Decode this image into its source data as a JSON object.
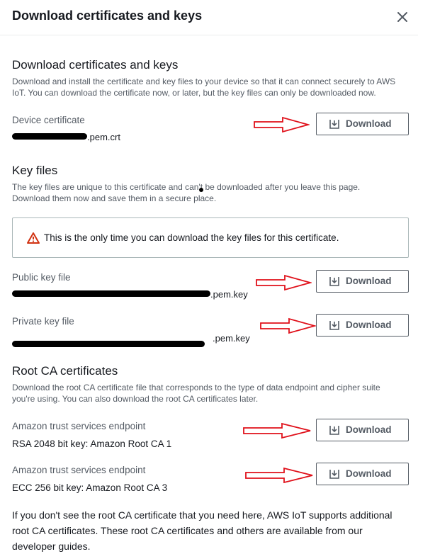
{
  "header": {
    "title": "Download certificates and keys",
    "close_icon": "close-icon"
  },
  "section_certs": {
    "heading": "Download certificates and keys",
    "description_line1": "Download and install the certificate and key files to your device so that it can connect securely to AWS",
    "description_line2": "IoT. You can download the certificate now, or later, but the key files can only be downloaded now."
  },
  "device_certificate": {
    "label": "Device certificate",
    "suffix": ".pem.crt",
    "button_label": "Download"
  },
  "section_keys": {
    "heading": "Key files",
    "description_line1": "The key files are unique to this certificate and can't be downloaded after you leave this page.",
    "description_line2": "Download them now and save them in a secure place."
  },
  "warning": {
    "text": "This is the only time you can download the key files for this certificate.",
    "icon": "warning-icon"
  },
  "public_key": {
    "label": "Public key file",
    "suffix": ".pem.key",
    "button_label": "Download"
  },
  "private_key": {
    "label": "Private key file",
    "suffix": ".pem.key",
    "button_label": "Download"
  },
  "section_root_ca": {
    "heading": "Root CA certificates",
    "description_line1": "Download the root CA certificate file that corresponds to the type of data endpoint and cipher suite",
    "description_line2": "you're using. You can also download the root CA certificates later."
  },
  "root_ca_1": {
    "label": "Amazon trust services endpoint",
    "value": "RSA 2048 bit key: Amazon Root CA 1",
    "button_label": "Download"
  },
  "root_ca_3": {
    "label": "Amazon trust services endpoint",
    "value": "ECC 256 bit key: Amazon Root CA 3",
    "button_label": "Download"
  },
  "footer": {
    "text": "If you don't see the root CA certificate that you need here, AWS IoT supports additional root CA certificates. These root CA certificates and others are available from our developer guides."
  },
  "colors": {
    "annotation_arrow": "#e0101a",
    "warning_red": "#d13212",
    "button_border": "#545b64"
  }
}
